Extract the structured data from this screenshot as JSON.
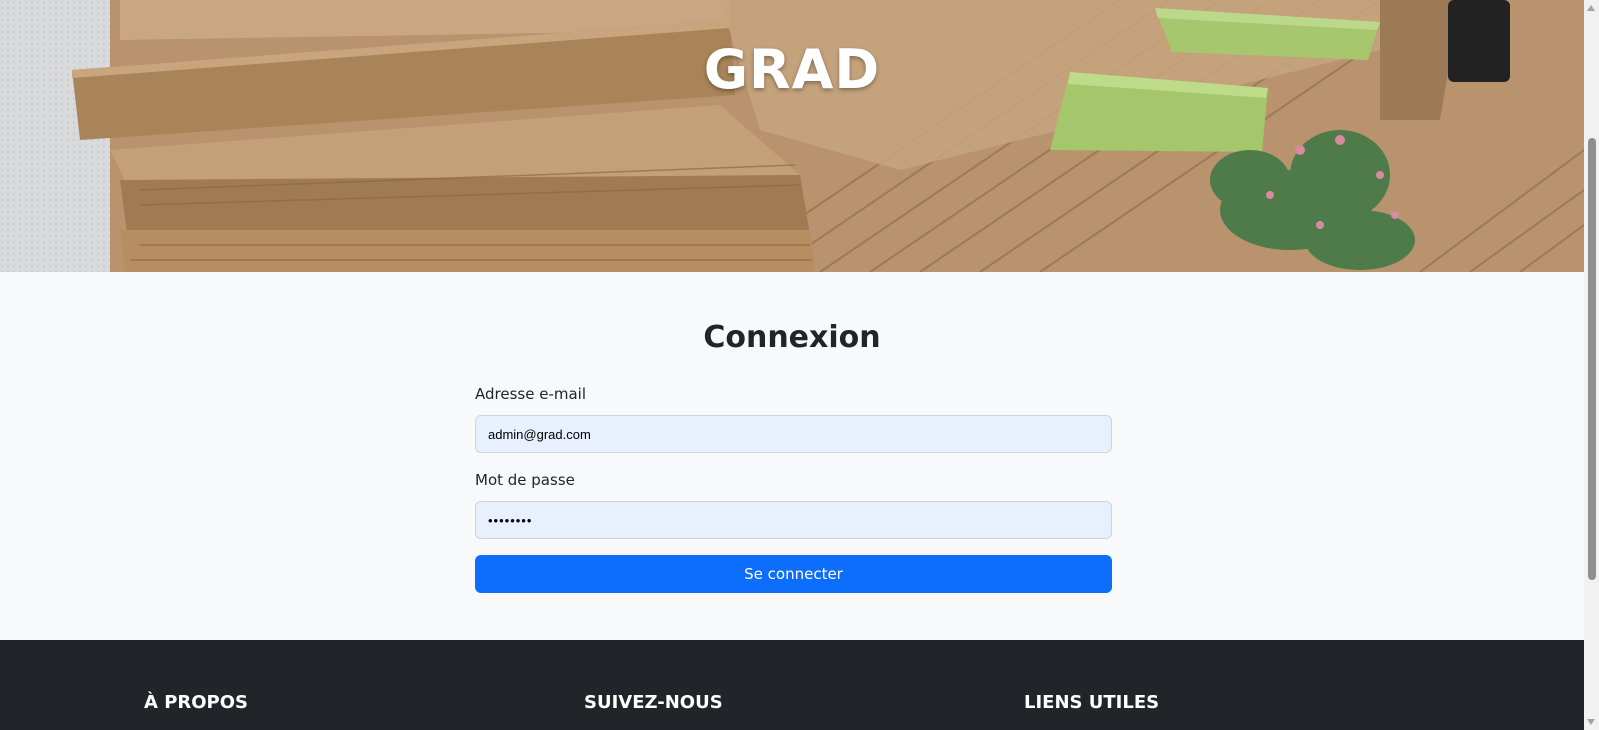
{
  "hero": {
    "title": "GRAD",
    "image_description": "wooden-deck-steps-with-green-cushions"
  },
  "login": {
    "title": "Connexion",
    "email_label": "Adresse e-mail",
    "email_value": "admin@grad.com",
    "password_label": "Mot de passe",
    "password_value": "secret12",
    "submit_label": "Se connecter"
  },
  "footer": {
    "headings": [
      "À PROPOS",
      "SUIVEZ-NOUS",
      "LIENS UTILES"
    ]
  },
  "colors": {
    "primary": "#0d6efd",
    "footer_bg": "#212529",
    "input_bg": "#e8f0fe",
    "page_bg": "#f8f9fa"
  }
}
